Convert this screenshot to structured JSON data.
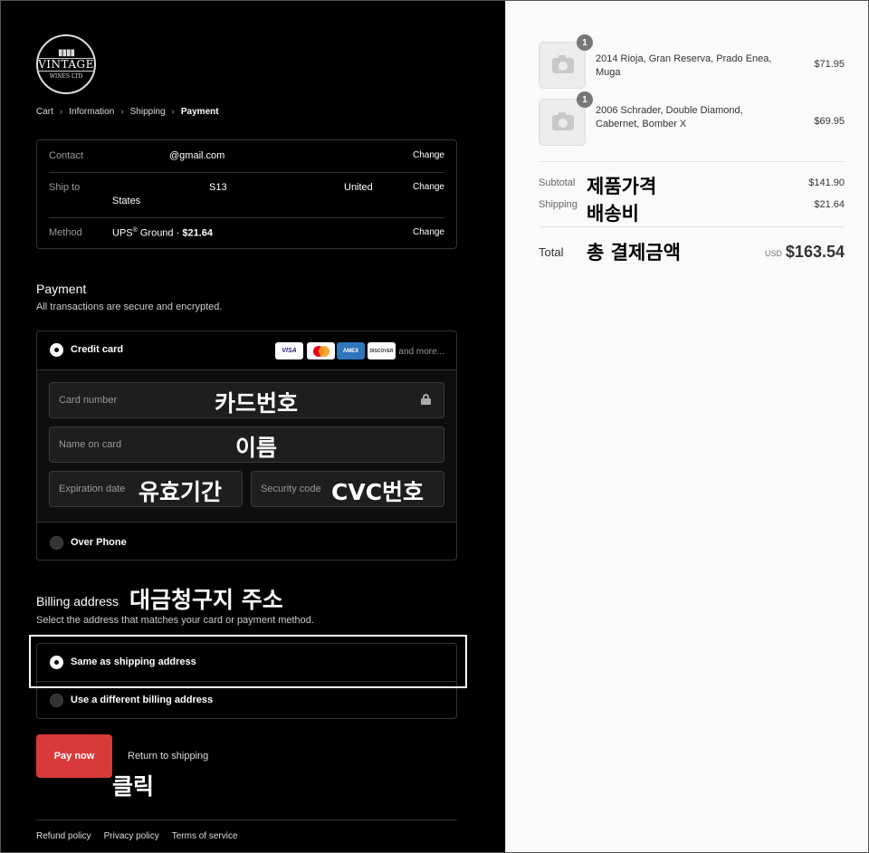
{
  "logo": {
    "line1": "VINTAGE",
    "line2": "WINES LTD",
    "bottles": "▮▮▮▮"
  },
  "breadcrumb": [
    "Cart",
    "Information",
    "Shipping",
    "Payment"
  ],
  "breadcrumb_sep": "›",
  "review": {
    "contact_label": "Contact",
    "contact_value": "@gmail.com",
    "ship_label": "Ship to",
    "ship_value_a": "S13",
    "ship_value_b": "United",
    "ship_value_c": "States",
    "method_label": "Method",
    "method_carrier": "UPS",
    "method_reg": "®",
    "method_service": " Ground · ",
    "method_price": "$21.64",
    "change_label": "Change"
  },
  "payment": {
    "heading": "Payment",
    "subtext": "All transactions are secure and encrypted.",
    "credit_card_label": "Credit card",
    "card_brands": [
      "VISA",
      "MC",
      "AMEX",
      "DISCOVER"
    ],
    "more_label": "and more...",
    "card_number_ph": "Card number",
    "card_number_note": "카드번호",
    "name_ph": "Name on card",
    "name_note": "이름",
    "expiry_ph": "Expiration date",
    "expiry_note": "유효기간",
    "security_ph": "Security code",
    "security_note": "CVC번호",
    "over_phone_label": "Over Phone"
  },
  "billing": {
    "heading": "Billing address",
    "heading_note": "대금청구지 주소",
    "subtext": "Select the address that matches your card or payment method.",
    "same_label": "Same as shipping address",
    "different_label": "Use a different billing address"
  },
  "actions": {
    "pay_now": "Pay now",
    "pay_note": "클릭",
    "return_link": "Return to shipping"
  },
  "footer_links": [
    "Refund policy",
    "Privacy policy",
    "Terms of service"
  ],
  "summary": {
    "items": [
      {
        "qty": "1",
        "name": "2014 Rioja, Gran Reserva, Prado Enea, Muga",
        "price": "$71.95"
      },
      {
        "qty": "1",
        "name": "2006 Schrader, Double Diamond, Cabernet, Bomber X",
        "price": "$69.95"
      }
    ],
    "subtotal_label": "Subtotal",
    "subtotal_note": "제품가격",
    "subtotal_value": "$141.90",
    "shipping_label": "Shipping",
    "shipping_note": "배송비",
    "shipping_value": "$21.64",
    "total_label": "Total",
    "total_note": "총 결제금액",
    "currency": "USD",
    "total_value": "$163.54"
  },
  "colors": {
    "pay_button": "#d93a3a",
    "left_bg": "#000000",
    "right_bg": "#fafafa"
  }
}
